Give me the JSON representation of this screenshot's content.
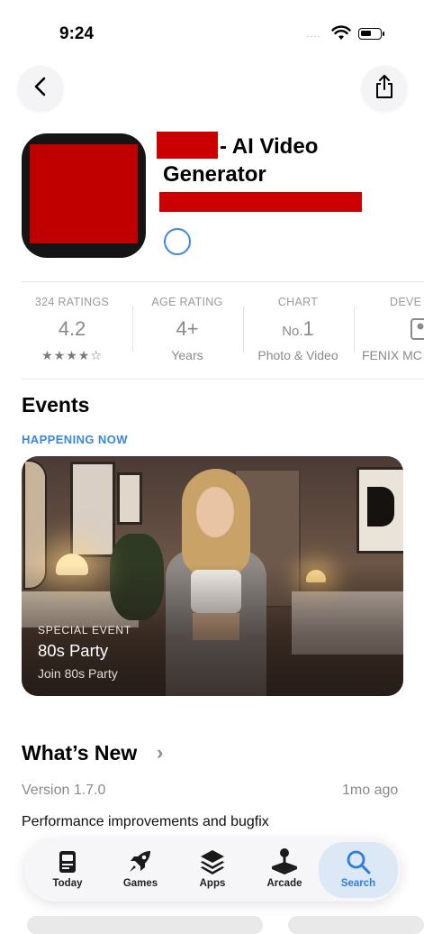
{
  "status_bar": {
    "time": "9:24",
    "signal": "....",
    "icons": [
      "wifi-icon",
      "battery-icon"
    ]
  },
  "nav": {
    "back_icon": "chevron-left-icon",
    "share_icon": "share-icon"
  },
  "app": {
    "title_part1": "- AI Video",
    "title_part2": "Generator"
  },
  "stats": [
    {
      "label": "324 RATINGS",
      "value": "4.2",
      "sub": "★★★★☆"
    },
    {
      "label": "AGE RATING",
      "value": "4+",
      "sub": "Years"
    },
    {
      "label": "CHART",
      "value_prefix": "No.",
      "value": "1",
      "sub": "Photo & Video"
    },
    {
      "label": "DEVE",
      "sub": "FENIX MC"
    }
  ],
  "events": {
    "title": "Events",
    "happening": "HAPPENING NOW",
    "card": {
      "tag": "SPECIAL EVENT",
      "name": "80s Party",
      "sub": "Join 80s Party"
    }
  },
  "whats_new": {
    "title": "What’s New",
    "chevron": "›",
    "version": "Version 1.7.0",
    "date": "1mo ago",
    "notes": "Performance improvements and bugfix"
  },
  "tabbar": {
    "tabs": [
      {
        "label": "Today",
        "icon": "today-icon"
      },
      {
        "label": "Games",
        "icon": "rocket-icon"
      },
      {
        "label": "Apps",
        "icon": "layers-icon"
      },
      {
        "label": "Arcade",
        "icon": "joystick-icon"
      },
      {
        "label": "Search",
        "icon": "search-icon",
        "active": true
      }
    ]
  },
  "colors": {
    "accent": "#3a87d9",
    "redaction": "#cc0000"
  }
}
